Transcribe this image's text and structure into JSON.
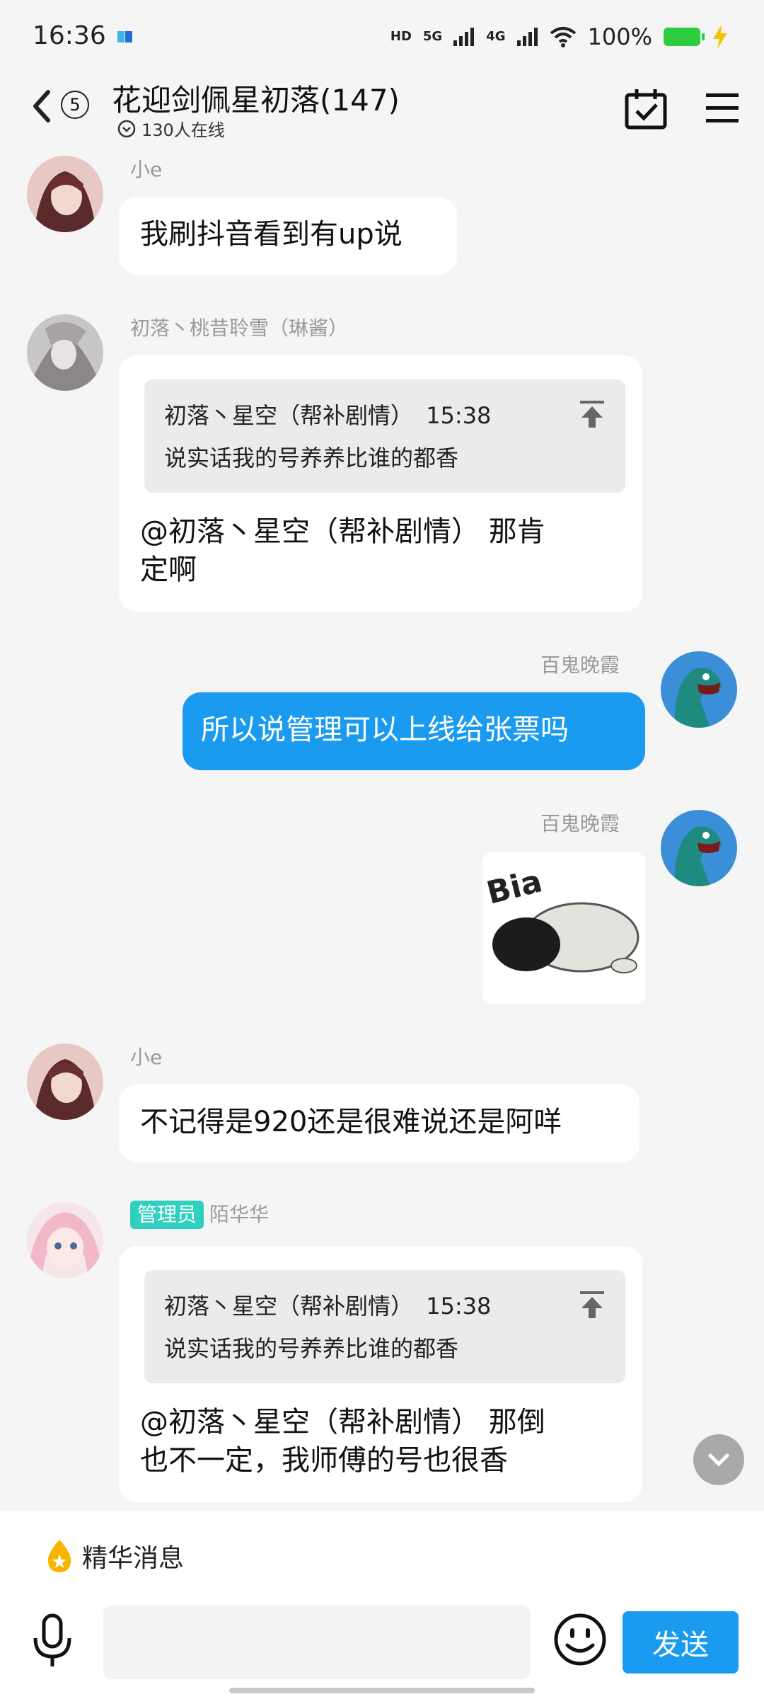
{
  "status_bar": {
    "time": "16:36",
    "hd_label": "HD",
    "net_5g": "5G",
    "net_4g": "4G",
    "battery": "100%"
  },
  "header": {
    "back_count": "5",
    "title": "花迎剑佩星初落(147)",
    "online": "130人在线"
  },
  "messages": [
    {
      "sender": "小e",
      "text": "我刷抖音看到有up说"
    },
    {
      "sender": "初落丶桃昔聆雪（琳酱）",
      "quote": {
        "author": "初落丶星空（帮补剧情）",
        "time": "15:38",
        "text": "说实话我的号养养比谁的都香"
      },
      "text_line1": "@初落丶星空（帮补剧情） 那肯",
      "text_line2": "定啊"
    },
    {
      "sender": "百鬼晚霞",
      "text": "所以说管理可以上线给张票吗"
    },
    {
      "sender": "百鬼晚霞",
      "sticker_text": "Bia"
    },
    {
      "sender": "小e",
      "text": "不记得是920还是很难说还是阿咩"
    },
    {
      "role": "管理员",
      "sender": "陌华华",
      "quote": {
        "author": "初落丶星空（帮补剧情）",
        "time": "15:38",
        "text": "说实话我的号养养比谁的都香"
      },
      "text_line1": "@初落丶星空（帮补剧情） 那倒",
      "text_line2": "也不一定，我师傅的号也很香"
    }
  ],
  "footer": {
    "digest_label": "精华消息",
    "input_value": "",
    "send_label": "发送"
  },
  "colors": {
    "accent": "#1a9bf0",
    "admin_tag": "#2fd0c0",
    "background": "#f5f5f5"
  }
}
